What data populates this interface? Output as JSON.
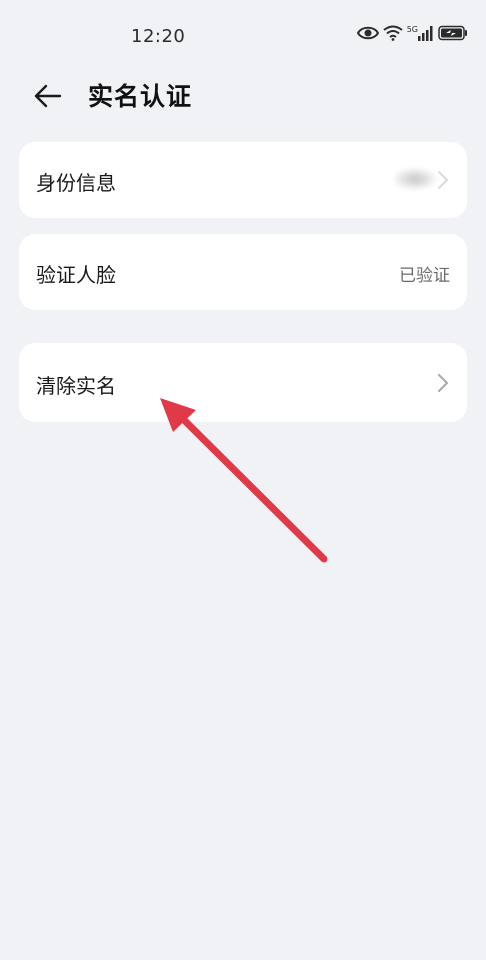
{
  "status_bar": {
    "time": "12:20",
    "network_label": "5G",
    "icons": [
      "eye-icon",
      "wifi-icon",
      "signal-icon",
      "battery-icon"
    ]
  },
  "header": {
    "title": "实名认证",
    "back_icon": "arrow-left-icon"
  },
  "items": [
    {
      "label": "身份信息",
      "value": "",
      "chevron": true,
      "obscured": true
    },
    {
      "label": "验证人脸",
      "value": "已验证",
      "chevron": false
    },
    {
      "label": "清除实名",
      "value": "",
      "chevron": true
    }
  ],
  "annotation": {
    "type": "red-arrow",
    "color": "#e03a48",
    "points_to": "清除实名"
  }
}
